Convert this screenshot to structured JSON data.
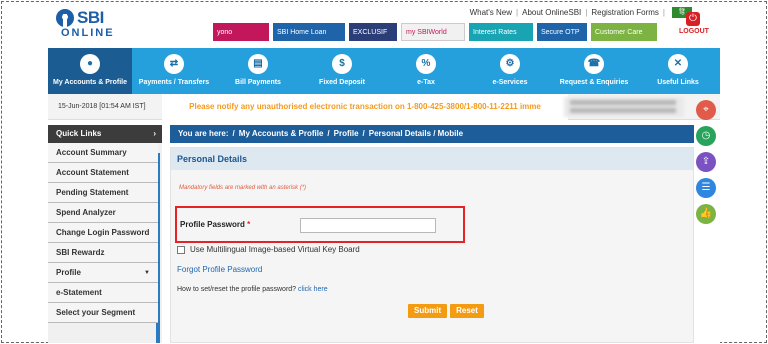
{
  "brand": {
    "line1": "SBI",
    "line2": "ONLINE"
  },
  "top_links": [
    "What's New",
    "About OnlineSBI",
    "Registration Forms"
  ],
  "language": "हिं",
  "banners": [
    {
      "label": "yono",
      "color": "#c2185b"
    },
    {
      "label": "SBI Home Loan",
      "color": "#1f63a8"
    },
    {
      "label": "EXCLUSIF",
      "color": "#2c3e77"
    },
    {
      "label": "my SBIWorld",
      "color": "#f1f1f1"
    },
    {
      "label": "Interest Rates",
      "color": "#18a4b3"
    },
    {
      "label": "Secure OTP",
      "color": "#1f63a8"
    },
    {
      "label": "Customer Care",
      "color": "#7cb342"
    }
  ],
  "logout": {
    "label": "LOGOUT",
    "icon": "power-icon"
  },
  "nav": [
    {
      "label": "My Accounts & Profile",
      "icon": "user-icon",
      "active": true
    },
    {
      "label": "Payments / Transfers",
      "icon": "transfer-icon",
      "active": false
    },
    {
      "label": "Bill Payments",
      "icon": "bill-icon",
      "active": false
    },
    {
      "label": "Fixed Deposit",
      "icon": "deposit-icon",
      "active": false
    },
    {
      "label": "e-Tax",
      "icon": "tax-icon",
      "active": false
    },
    {
      "label": "e-Services",
      "icon": "services-icon",
      "active": false
    },
    {
      "label": "Request & Enquiries",
      "icon": "enquiry-icon",
      "active": false
    },
    {
      "label": "Useful Links",
      "icon": "links-icon",
      "active": false
    }
  ],
  "datetime": "15-Jun-2018 [01:54 AM IST]",
  "alert": "Please notify any unauthorised electronic transaction on 1-800-425-3800/1-800-11-2211 imme",
  "quick_links": "Quick Links",
  "sidebar": [
    {
      "label": "Account Summary",
      "dropdown": false
    },
    {
      "label": "Account Statement",
      "dropdown": false
    },
    {
      "label": "Pending Statement",
      "dropdown": false
    },
    {
      "label": "Spend Analyzer",
      "dropdown": false
    },
    {
      "label": "Change Login Password",
      "dropdown": false
    },
    {
      "label": "SBI Rewardz",
      "dropdown": false
    },
    {
      "label": "Profile",
      "dropdown": true
    },
    {
      "label": "e-Statement",
      "dropdown": false
    },
    {
      "label": "Select your Segment",
      "dropdown": false
    }
  ],
  "breadcrumb": [
    "You are here:",
    "/",
    "My Accounts & Profile",
    "/",
    "Profile",
    "/",
    "Personal Details / Mobile"
  ],
  "panel": {
    "title": "Personal Details",
    "mandatory": "Mandatory fields are marked with an asterisk (*)",
    "password_label": "Profile Password",
    "required_mark": "*",
    "password_value": "",
    "vkb_label": "Use Multilingual Image-based Virtual Key Board",
    "vkb_checked": false,
    "forgot": "Forgot Profile Password",
    "howto": "How to set/reset the profile password?",
    "howto_link": "click here",
    "submit": "Submit",
    "reset": "Reset"
  },
  "floaters": [
    {
      "icon": "location-icon",
      "color": "#e15b4a"
    },
    {
      "icon": "clock-icon",
      "color": "#27a35b"
    },
    {
      "icon": "share-icon",
      "color": "#7a52c1"
    },
    {
      "icon": "contact-icon",
      "color": "#2e86de"
    },
    {
      "icon": "thumbs-up-icon",
      "color": "#7cb342"
    }
  ]
}
